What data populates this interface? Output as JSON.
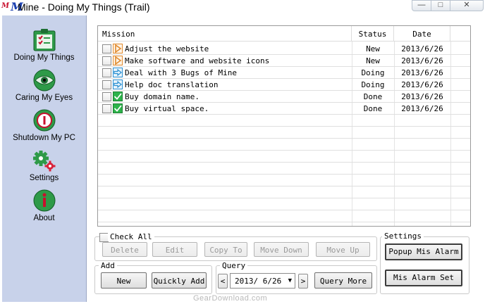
{
  "window": {
    "logo_text": "M",
    "title": "Mine - Doing My Things (Trail)",
    "min_glyph": "—",
    "max_glyph": "□",
    "close_glyph": "✕"
  },
  "sidebar": {
    "items": [
      {
        "label": "Doing My Things",
        "icon": "checklist-icon"
      },
      {
        "label": "Caring My Eyes",
        "icon": "eye-icon"
      },
      {
        "label": "Shutdown My PC",
        "icon": "power-icon"
      },
      {
        "label": "Settings",
        "icon": "gears-icon"
      },
      {
        "label": "About",
        "icon": "info-icon"
      }
    ]
  },
  "table": {
    "headers": {
      "mission": "Mission",
      "status": "Status",
      "date": "Date"
    },
    "rows": [
      {
        "mission": "Adjust the website",
        "status": "New",
        "date": "2013/6/26",
        "icon": "play-icon"
      },
      {
        "mission": "Make software and website icons",
        "status": "New",
        "date": "2013/6/26",
        "icon": "play-icon"
      },
      {
        "mission": "Deal with 3 Bugs of Mine",
        "status": "Doing",
        "date": "2013/6/26",
        "icon": "arrow-icon"
      },
      {
        "mission": "Help doc translation",
        "status": "Doing",
        "date": "2013/6/26",
        "icon": "arrow-icon"
      },
      {
        "mission": "Buy domain name.",
        "status": "Done",
        "date": "2013/6/26",
        "icon": "check-icon"
      },
      {
        "mission": "Buy virtual space.",
        "status": "Done",
        "date": "2013/6/26",
        "icon": "check-icon"
      }
    ]
  },
  "actions": {
    "check_all": "Check All",
    "delete": "Delete",
    "edit": "Edit",
    "copy_to": "Copy To",
    "move_down": "Move Down",
    "move_up": "Move Up"
  },
  "add": {
    "title": "Add",
    "new": "New",
    "quickly_add": "Quickly Add"
  },
  "query": {
    "title": "Query",
    "prev": "<",
    "date": "2013/ 6/26",
    "next": ">",
    "query_more": "Query More"
  },
  "settings": {
    "title": "Settings",
    "popup_alarm": "Popup Mis Alarm",
    "alarm_set": "Mis Alarm Set"
  },
  "watermark": "GearDownload.com",
  "colors": {
    "sidebar_bg": "#c8d2ea",
    "icon_green": "#1f8a3a",
    "status_done": "#2db34a",
    "play_orange": "#e08a2e",
    "arrow_blue": "#2a8fd1"
  }
}
